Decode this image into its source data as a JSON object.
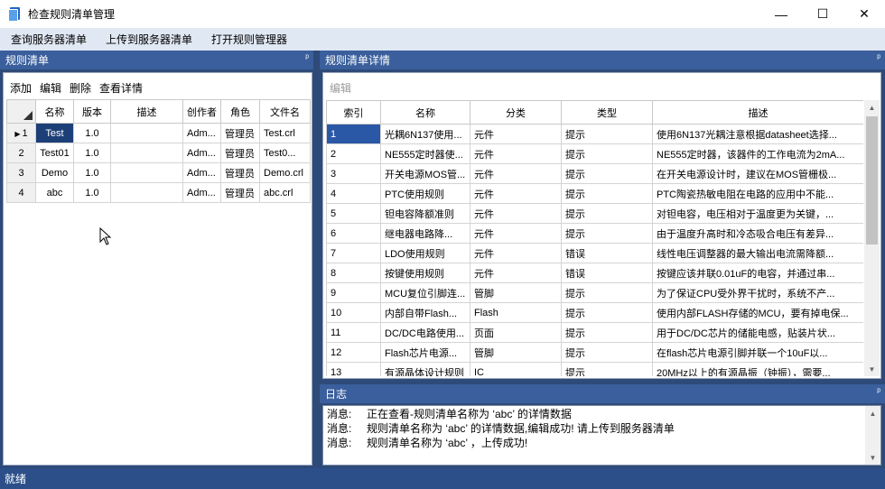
{
  "window": {
    "title": "检查规则清单管理",
    "minimize_glyph": "—",
    "maximize_glyph": "☐",
    "close_glyph": "✕"
  },
  "menu": [
    "查询服务器清单",
    "上传到服务器清单",
    "打开规则管理器"
  ],
  "left_panel": {
    "title": "规则清单",
    "pin_glyph": "ᵖ",
    "toolbar": [
      "添加",
      "编辑",
      "删除",
      "查看详情"
    ],
    "columns": [
      "名称",
      "版本",
      "描述",
      "创作者",
      "角色",
      "文件名"
    ],
    "rows": [
      {
        "index": "1",
        "name": "Test",
        "version": "1.0",
        "desc": "",
        "author": "Adm...",
        "role": "管理员",
        "file": "Test.crl"
      },
      {
        "index": "2",
        "name": "Test01",
        "version": "1.0",
        "desc": "",
        "author": "Adm...",
        "role": "管理员",
        "file": "Test0..."
      },
      {
        "index": "3",
        "name": "Demo",
        "version": "1.0",
        "desc": "",
        "author": "Adm...",
        "role": "管理员",
        "file": "Demo.crl"
      },
      {
        "index": "4",
        "name": "abc",
        "version": "1.0",
        "desc": "",
        "author": "Adm...",
        "role": "管理员",
        "file": "abc.crl"
      }
    ]
  },
  "right_panel": {
    "title": "规则清单详情",
    "pin_glyph": "ᵖ",
    "toolbar": [
      "编辑"
    ],
    "columns": [
      "索引",
      "名称",
      "分类",
      "类型",
      "描述"
    ],
    "rows": [
      {
        "index": "1",
        "name": "光耦6N137使用...",
        "category": "元件",
        "type": "提示",
        "desc": "使用6N137光耦注意根据datasheet选择..."
      },
      {
        "index": "2",
        "name": "NE555定时器使...",
        "category": "元件",
        "type": "提示",
        "desc": "NE555定时器，该器件的工作电流为2mA..."
      },
      {
        "index": "3",
        "name": "开关电源MOS管...",
        "category": "元件",
        "type": "提示",
        "desc": "在开关电源设计时，建议在MOS管栅极..."
      },
      {
        "index": "4",
        "name": "PTC使用规则",
        "category": "元件",
        "type": "提示",
        "desc": "PTC陶瓷热敏电阻在电路的应用中不能..."
      },
      {
        "index": "5",
        "name": "钽电容降额准则",
        "category": "元件",
        "type": "提示",
        "desc": "对钽电容，电压相对于温度更为关键，..."
      },
      {
        "index": "6",
        "name": "继电器电路降...",
        "category": "元件",
        "type": "提示",
        "desc": "由于温度升高时和冷态吸合电压有差异..."
      },
      {
        "index": "7",
        "name": "LDO使用规则",
        "category": "元件",
        "type": "错误",
        "desc": "线性电压调整器的最大输出电流需降额..."
      },
      {
        "index": "8",
        "name": "按键使用规则",
        "category": "元件",
        "type": "错误",
        "desc": "按键应该并联0.01uF的电容，并通过串..."
      },
      {
        "index": "9",
        "name": "MCU复位引脚连...",
        "category": "管脚",
        "type": "提示",
        "desc": "为了保证CPU受外界干扰时，系统不产..."
      },
      {
        "index": "10",
        "name": "内部自带Flash...",
        "category": "Flash",
        "type": "提示",
        "desc": "使用内部FLASH存储的MCU，要有掉电保..."
      },
      {
        "index": "11",
        "name": "DC/DC电路使用...",
        "category": "页面",
        "type": "提示",
        "desc": "用于DC/DC芯片的储能电感，贴装片状..."
      },
      {
        "index": "12",
        "name": "Flash芯片电源...",
        "category": "管脚",
        "type": "提示",
        "desc": "在flash芯片电源引脚并联一个10uF以..."
      },
      {
        "index": "13",
        "name": "有源晶体设计规则",
        "category": "IC",
        "type": "提示",
        "desc": "20MHz以上的有源晶振（钟振），需要..."
      }
    ]
  },
  "log_panel": {
    "title": "日志",
    "pin_glyph": "ᵖ",
    "entries": [
      {
        "type": "消息:",
        "text": "正在查看-规则清单名称为 ‘abc’ 的详情数据"
      },
      {
        "type": "消息:",
        "text": "规则清单名称为 ‘abc’ 的详情数据,编辑成功! 请上传到服务器清单"
      },
      {
        "type": "消息:",
        "text": "规则清单名称为 ‘abc’ ，上传成功!"
      }
    ]
  },
  "status": "就绪",
  "colors": {
    "accent_dark": "#2e4a78",
    "header": "#3a5f9c",
    "selection": "#1c3f78"
  },
  "icons": [
    "app-document-icon",
    "pin-icon",
    "row-pointer-icon",
    "mouse-pointer-icon"
  ]
}
